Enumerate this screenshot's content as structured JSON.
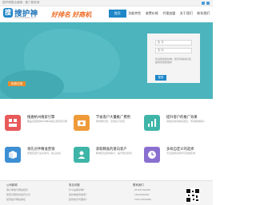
{
  "topbar": {
    "text": "搜护神整合营销 · 推广服务商"
  },
  "header": {
    "logo_glyph": "搜",
    "brand": "搜护神",
    "brand_sub": "www.souhushen.com",
    "slogan": "好排名 好商机"
  },
  "nav": [
    {
      "label": "首页",
      "active": true
    },
    {
      "label": "功能特色",
      "active": false
    },
    {
      "label": "收费价格",
      "active": false
    },
    {
      "label": "代理加盟",
      "active": false
    },
    {
      "label": "关于我们",
      "active": false
    },
    {
      "label": "联系我们",
      "active": false
    }
  ],
  "banner": {
    "button_label": "免费试用"
  },
  "login": {
    "username_placeholder": "账 号",
    "password_placeholder": "密 码",
    "note": "欢迎使用搜护神，我们将竭诚为您提供优质的服务",
    "button_label": "登录"
  },
  "features": [
    {
      "icon": "grid-icon",
      "color": "#e85a5a",
      "title": "搜遍杭州搜索引擎",
      "desc": "覆盖百度搜狗360神马等主流搜索引擎"
    },
    {
      "icon": "money-icon",
      "color": "#ef9b3a",
      "title": "节省客户大量推广费用",
      "desc": "按效果付费，无排名不扣费"
    },
    {
      "icon": "chart-icon",
      "color": "#3fb5a8",
      "title": "提升客户的推广效果",
      "desc": "海量关键词排名首页，带来精准客户"
    },
    {
      "icon": "box-icon",
      "color": "#3d8fd4",
      "title": "领先对手精准营销",
      "desc": "智能匹配行业关键词，抢占先机"
    },
    {
      "icon": "people-icon",
      "color": "#3fb5a8",
      "title": "获取精准的意向客户",
      "desc": "精准定位意向客户，提升成交转化"
    },
    {
      "icon": "clock-icon",
      "color": "#8a6fd0",
      "title": "多样自定义的选择",
      "desc": "灵活选择关键词与投放区域"
    }
  ],
  "footer": {
    "col1_title": "公司新闻",
    "col1_lines": [
      "用户体验与网站优化",
      "搜索引擎优化技巧分享",
      "如何提升网站排名"
    ],
    "col2_title": "常见问题",
    "col2_lines": [
      "什么是搜护神？",
      "搜护神如何收费？",
      "如何成为代理商？"
    ],
    "col3_title": "联系我们",
    "col3_lines": [
      "057187432460",
      "13621550650",
      "0755-23913582"
    ]
  }
}
